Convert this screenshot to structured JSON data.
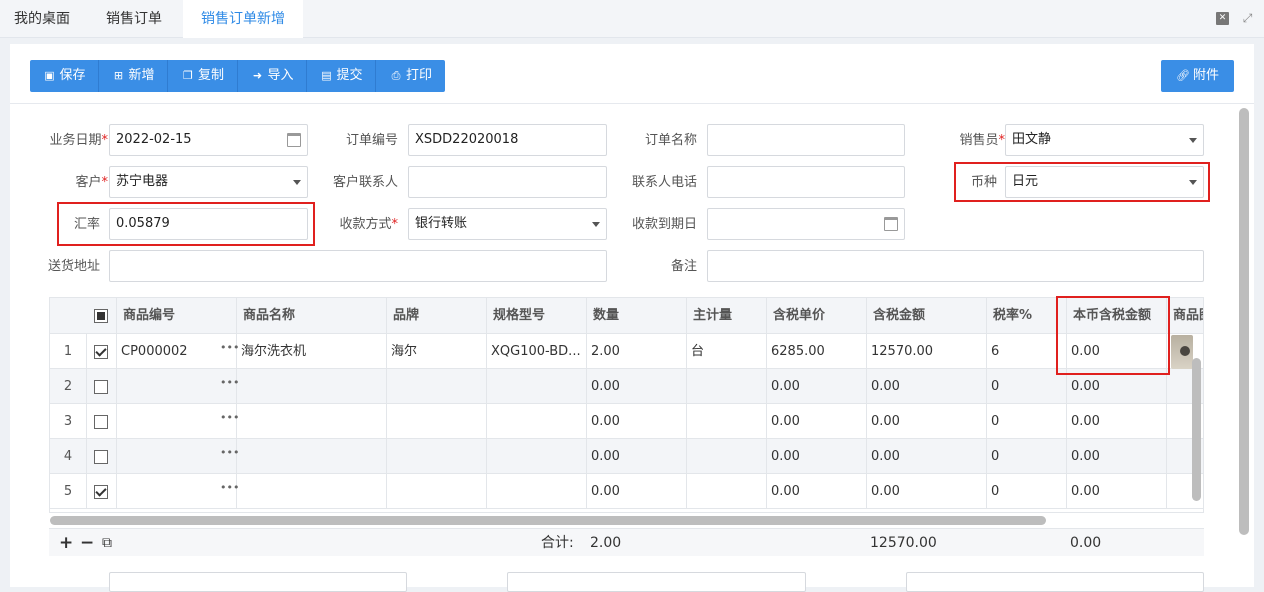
{
  "tabs": [
    {
      "label": "我的桌面"
    },
    {
      "label": "销售订单"
    },
    {
      "label": "销售订单新增"
    }
  ],
  "window_controls": {
    "close": "✕",
    "maximize": "⤢"
  },
  "toolbar": {
    "save": "保存",
    "add": "新增",
    "copy": "复制",
    "import": "导入",
    "submit": "提交",
    "print": "打印",
    "attach": "附件"
  },
  "form": {
    "biz_date_label": "业务日期",
    "biz_date": "2022-02-15",
    "order_no_label": "订单编号",
    "order_no": "XSDD22020018",
    "order_name_label": "订单名称",
    "order_name": "",
    "salesperson_label": "销售员",
    "salesperson": "田文静",
    "customer_label": "客户",
    "customer": "苏宁电器",
    "contact_label": "客户联系人",
    "contact": "",
    "contact_phone_label": "联系人电话",
    "contact_phone": "",
    "currency_label": "币种",
    "currency": "日元",
    "rate_label": "汇率",
    "rate": "0.05879",
    "pay_method_label": "收款方式",
    "pay_method": "银行转账",
    "due_date_label": "收款到期日",
    "due_date": "",
    "address_label": "送货地址",
    "address": "",
    "remark_label": "备注",
    "remark": ""
  },
  "grid": {
    "columns": [
      "商品编号",
      "商品名称",
      "品牌",
      "规格型号",
      "数量",
      "主计量",
      "含税单价",
      "含税金额",
      "税率%",
      "本币含税金额",
      "商品图"
    ],
    "rows": [
      {
        "no": "1",
        "checked": true,
        "code": "CP000002",
        "name": "海尔洗衣机",
        "brand": "海尔",
        "spec": "XQG100-BD...",
        "qty": "2.00",
        "unit": "台",
        "price": "6285.00",
        "amount": "12570.00",
        "tax": "6",
        "local_amount": "0.00"
      },
      {
        "no": "2",
        "checked": false,
        "code": "",
        "name": "",
        "brand": "",
        "spec": "",
        "qty": "0.00",
        "unit": "",
        "price": "0.00",
        "amount": "0.00",
        "tax": "0",
        "local_amount": "0.00"
      },
      {
        "no": "3",
        "checked": false,
        "code": "",
        "name": "",
        "brand": "",
        "spec": "",
        "qty": "0.00",
        "unit": "",
        "price": "0.00",
        "amount": "0.00",
        "tax": "0",
        "local_amount": "0.00"
      },
      {
        "no": "4",
        "checked": false,
        "code": "",
        "name": "",
        "brand": "",
        "spec": "",
        "qty": "0.00",
        "unit": "",
        "price": "0.00",
        "amount": "0.00",
        "tax": "0",
        "local_amount": "0.00"
      },
      {
        "no": "5",
        "checked": true,
        "code": "",
        "name": "",
        "brand": "",
        "spec": "",
        "qty": "0.00",
        "unit": "",
        "price": "0.00",
        "amount": "0.00",
        "tax": "0",
        "local_amount": "0.00"
      }
    ],
    "dots": "•••"
  },
  "footer": {
    "add": "+",
    "remove": "−",
    "copy": "⧉",
    "total_label": "合计:",
    "total_qty": "2.00",
    "total_amount": "12570.00",
    "total_local": "0.00"
  },
  "colors": {
    "accent": "#3a8ee6",
    "highlight": "#e0201e"
  }
}
